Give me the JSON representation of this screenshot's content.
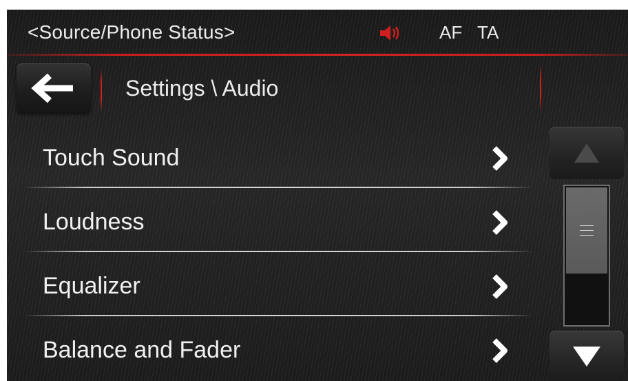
{
  "status_bar": {
    "source_status": "<Source/Phone Status>",
    "speaker_icon": "speaker-muted-icon",
    "af_label": "AF",
    "ta_label": "TA",
    "accent_color": "#d01f1f"
  },
  "header": {
    "back_icon": "arrow-left-icon",
    "breadcrumb": "Settings \\ Audio"
  },
  "menu": {
    "items": [
      {
        "label": "Touch Sound",
        "icon": "chevron-right-icon"
      },
      {
        "label": "Loudness",
        "icon": "chevron-right-icon"
      },
      {
        "label": "Equalizer",
        "icon": "chevron-right-icon"
      },
      {
        "label": "Balance and Fader",
        "icon": "chevron-right-icon"
      }
    ]
  },
  "scrollbar": {
    "up_icon": "triangle-up-icon",
    "down_icon": "triangle-down-icon",
    "thumb_position": 0.0,
    "thumb_fraction": 0.63
  }
}
